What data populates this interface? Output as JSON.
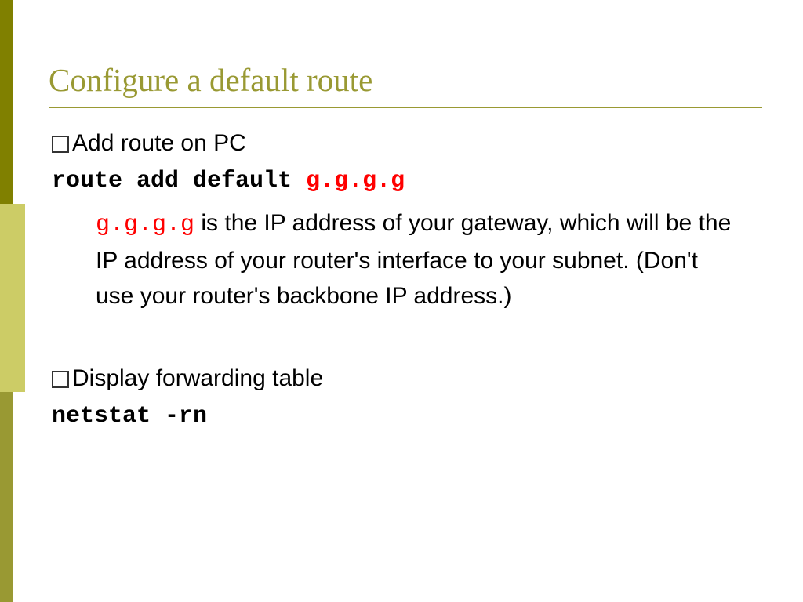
{
  "title": "Configure a default route",
  "bullet1": "Add route on PC",
  "cmd1_prefix": "route add default ",
  "cmd1_arg": "g.g.g.g",
  "explain_var": "g.g.g.g",
  "explain_rest": " is the IP address of your gateway, which will be the IP address of your router's interface to your subnet.  (Don't use your router's backbone IP address.)",
  "bullet2": "Display forwarding table",
  "cmd2": "netstat -rn"
}
